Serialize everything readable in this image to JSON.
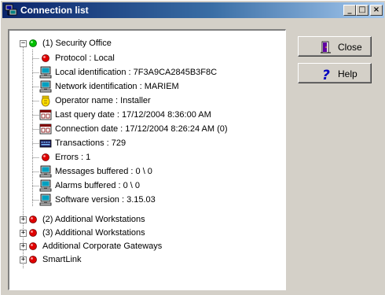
{
  "window": {
    "title": "Connection list",
    "icon": "computer-network-icon",
    "buttons": {
      "minimize": "_",
      "maximize": "□",
      "close": "×"
    }
  },
  "tree": {
    "root": {
      "label": "(1) Security Office",
      "status": "connected",
      "icon": "green-dot-icon",
      "children": [
        {
          "label": "Protocol : Local",
          "icon": "red-dot-icon"
        },
        {
          "label": "Local identification : 7F3A9CA2845B3F8C",
          "icon": "computer-icon"
        },
        {
          "label": "Network identification : MARIEM",
          "icon": "computer-icon"
        },
        {
          "label": "Operator name : Installer",
          "icon": "operator-icon"
        },
        {
          "label": "Last query date : 17/12/2004 8:36:00 AM",
          "icon": "calendar-icon"
        },
        {
          "label": "Connection date : 17/12/2004 8:26:24 AM  (0)",
          "icon": "calendar-icon"
        },
        {
          "label": "Transactions : 729",
          "icon": "transactions-icon"
        },
        {
          "label": "Errors : 1",
          "icon": "red-dot-icon"
        },
        {
          "label": "Messages buffered : 0 \\ 0",
          "icon": "computer-icon"
        },
        {
          "label": "Alarms buffered : 0 \\ 0",
          "icon": "computer-icon"
        },
        {
          "label": "Software version : 3.15.03",
          "icon": "computer-icon"
        }
      ]
    },
    "others": [
      {
        "label": "(2) Additional Workstations",
        "icon": "red-dot-icon"
      },
      {
        "label": "(3) Additional Workstations",
        "icon": "red-dot-icon"
      },
      {
        "label": "Additional Corporate Gateways",
        "icon": "red-dot-icon"
      },
      {
        "label": "SmartLink",
        "icon": "red-dot-icon"
      }
    ]
  },
  "actions": {
    "close_label": "Close",
    "help_label": "Help"
  },
  "colors": {
    "title_start": "#0a246a",
    "title_end": "#a6caf0",
    "connected": "#00c000",
    "error": "#e00000",
    "face": "#d4d0c8"
  }
}
